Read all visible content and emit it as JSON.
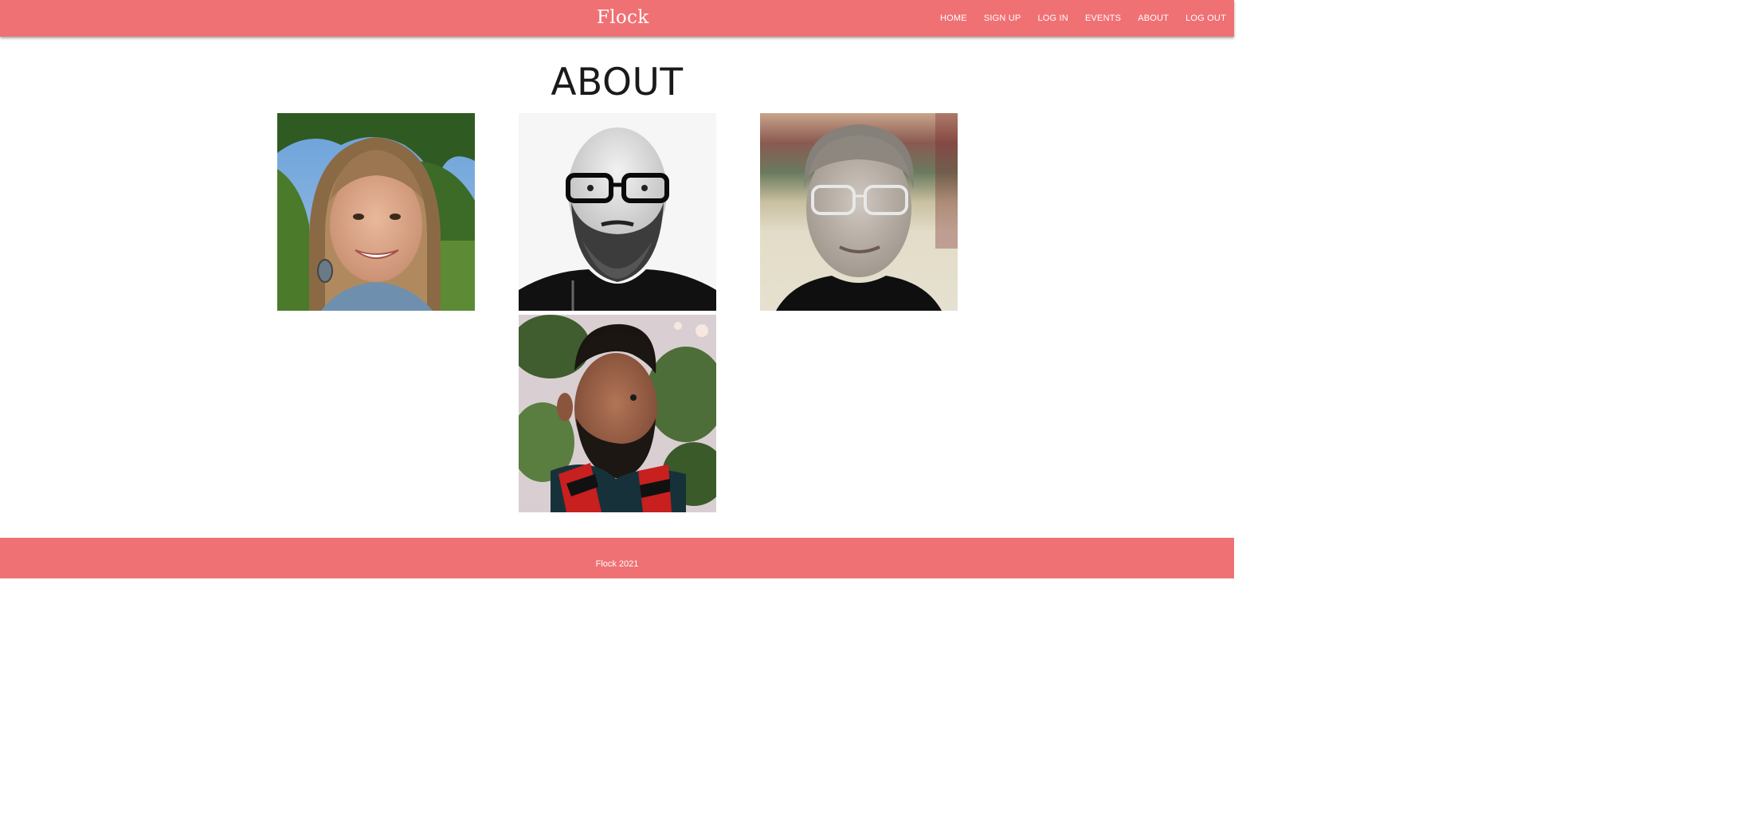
{
  "header": {
    "brand": "Flock",
    "nav": [
      {
        "label": "HOME"
      },
      {
        "label": "SIGN UP"
      },
      {
        "label": "LOG IN"
      },
      {
        "label": "EVENTS"
      },
      {
        "label": "ABOUT"
      },
      {
        "label": "LOG OUT"
      }
    ]
  },
  "main": {
    "title": "ABOUT"
  },
  "footer": {
    "text": "Flock 2021"
  },
  "colors": {
    "accent": "#f07174",
    "text_dark": "#1a1a1a",
    "background": "#ffffff"
  }
}
